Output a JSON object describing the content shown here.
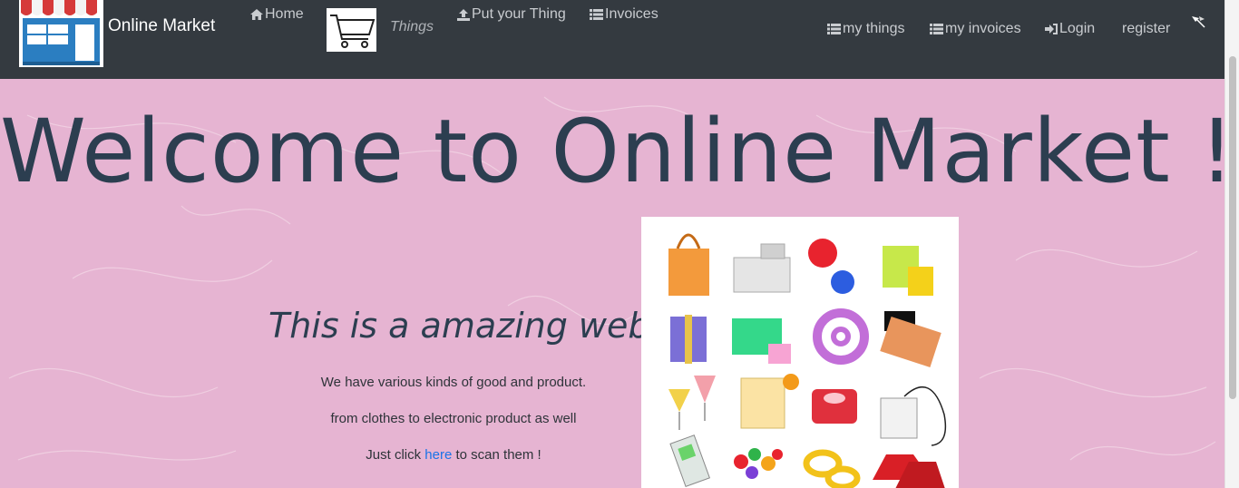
{
  "brand": {
    "name": "Online Market"
  },
  "nav": {
    "home": "Home",
    "things": "Things",
    "put_thing": "Put your Thing",
    "invoices": "Invoices",
    "my_things": "my things",
    "my_invoices": "my invoices",
    "login": "Login",
    "register": "register"
  },
  "hero": {
    "title": "Welcome to Online Market !!",
    "tagline": "This is a amazing web!!",
    "line1": "We have various kinds of good and product.",
    "line2": "from clothes to electronic product as well",
    "line3_before": "Just click ",
    "line3_link": "here",
    "line3_after": " to scan them !"
  },
  "colors": {
    "navbar": "#343a40",
    "background": "#e6b4d2",
    "heading": "#2c3e50",
    "link": "#1a73e8"
  },
  "icons": [
    "store-logo-icon",
    "home-icon",
    "cart-icon",
    "upload-icon",
    "list-icon",
    "sign-in-icon",
    "flag-icon"
  ]
}
